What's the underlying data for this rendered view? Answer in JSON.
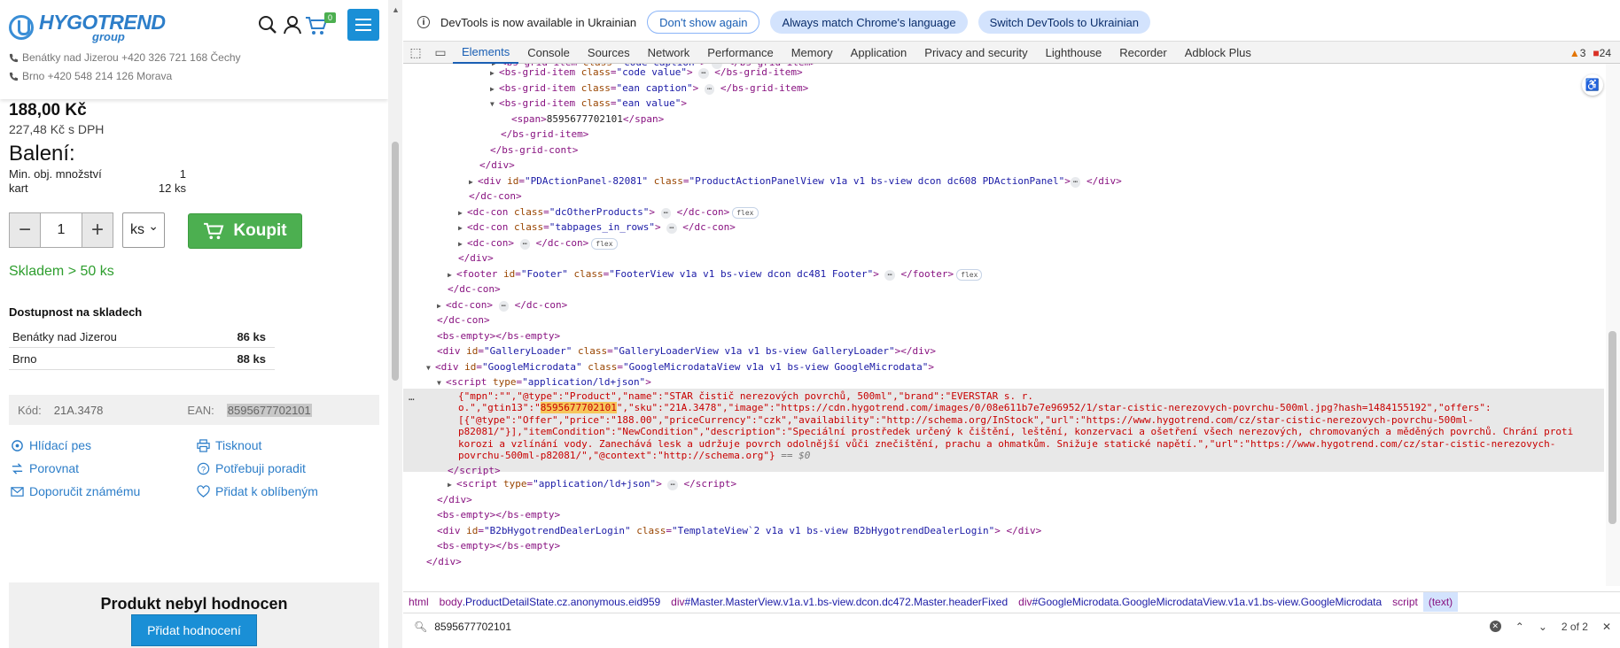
{
  "store": {
    "logo": {
      "name": "HYGOTREND",
      "sub": "group"
    },
    "cart_count": "0",
    "contacts": [
      "Benátky nad Jizerou +420 326 721 168 Čechy",
      "Brno +420 548 214 126 Morava"
    ],
    "price": "188,00 Kč",
    "price_vat": "227,48 Kč s DPH",
    "packaging_title": "Balení:",
    "min_order_label": "Min. obj. množství",
    "min_order_value": "1",
    "carton_label": "kart",
    "carton_value": "12 ks",
    "qty_minus": "−",
    "qty_value": "1",
    "qty_plus": "+",
    "unit": "ks",
    "buy_label": "Koupit",
    "stock": "Skladem > 50 ks",
    "availability_title": "Dostupnost na skladech",
    "warehouses": [
      {
        "name": "Benátky nad Jizerou",
        "qty": "86 ks"
      },
      {
        "name": "Brno",
        "qty": "88 ks"
      }
    ],
    "code_label": "Kód:",
    "code_value": "21A.3478",
    "ean_label": "EAN:",
    "ean_value": "8595677702101",
    "links": {
      "watchdog": "Hlídací pes",
      "print": "Tisknout",
      "compare": "Porovnat",
      "advice": "Potřebuji poradit",
      "recommend": "Doporučit známému",
      "favorite": "Přidat k oblíbeným"
    },
    "rating_title": "Produkt nebyl hodnocen",
    "rating_button": "Přidat hodnocení"
  },
  "devtools": {
    "info_text": "DevTools is now available in Ukrainian",
    "btn_dont_show": "Don't show again",
    "btn_match": "Always match Chrome's language",
    "btn_switch": "Switch DevTools to Ukrainian",
    "tabs": [
      "Elements",
      "Console",
      "Sources",
      "Network",
      "Performance",
      "Memory",
      "Application",
      "Privacy and security",
      "Lighthouse",
      "Recorder",
      "Adblock Plus"
    ],
    "warnings": "3",
    "errors": "24",
    "json_ld": {
      "line1a": "{\"mpn\":\"\",\"@type\":\"Product\",\"name\":\"STAR čistič nerezových povrchů, 500ml\",\"brand\":\"EVERSTAR s. r.",
      "line2a": "o.\",\"gtin13\":\"",
      "match": "8595677702101",
      "line2b": "\",\"sku\":\"21A.3478\",\"image\":\"https://cdn.hygotrend.com/images/0/08e611b7e7e96952/1/star-cistic-nerezovych-povrchu-500ml.jpg?hash=1484155192\",\"offers\":",
      "line3": "[{\"@type\":\"Offer\",\"price\":\"188.00\",\"priceCurrency\":\"czk\",\"availability\":\"http://schema.org/InStock\",\"url\":\"https://www.hygotrend.com/cz/star-cistic-nerezovych-povrchu-500ml-",
      "line4": "p82081/\"}],\"itemCondition\":\"NewCondition\",\"description\":\"Speciální prostředek určený k čištění, leštění, konzervaci a ošetření všech nerezových, chromovaných a měděných povrchů. Chrání proti",
      "line5": "korozi a vzlínání vody. Zanechává lesk a udržuje povrch odolnější vůči znečištění, prachu a ohmatkům. Snižuje statické napětí.\",\"url\":\"https://www.hygotrend.com/cz/star-cistic-nerezovych-",
      "line6": "povrchu-500ml-p82081/\",\"@context\":\"http://schema.org\"}",
      "suffix": " == $0"
    },
    "crumbs": [
      {
        "n": "html",
        "c": ""
      },
      {
        "n": "body",
        "c": ".ProductDetailState.cz.anonymous.eid959"
      },
      {
        "n": "div",
        "c": "#Master.MasterView.v1a.v1.bs-view.dcon.dc472.Master.headerFixed"
      },
      {
        "n": "div",
        "c": "#GoogleMicrodata.GoogleMicrodataView.v1a.v1.bs-view.GoogleMicrodata"
      },
      {
        "n": "script",
        "c": ""
      },
      {
        "n": "(text)",
        "c": ""
      }
    ],
    "search_query": "8595677702101",
    "search_count": "2 of 2"
  }
}
